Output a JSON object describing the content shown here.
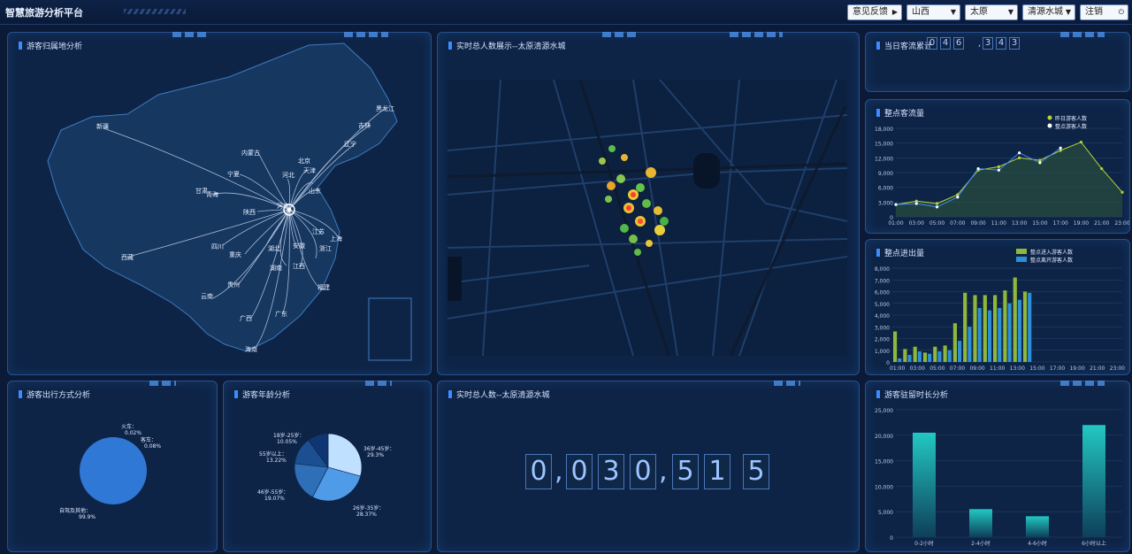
{
  "header": {
    "title": "智慧旅游分析平台",
    "feedback_label": "意见反馈",
    "selects": [
      {
        "value": "山西"
      },
      {
        "value": "太原"
      },
      {
        "value": "清源水城"
      }
    ],
    "logout_label": "注销"
  },
  "panels": {
    "origin": {
      "title": "游客归属地分析",
      "labels": [
        "黑龙江",
        "吉林",
        "辽宁",
        "新疆",
        "内蒙古",
        "宁夏",
        "甘肃",
        "青海",
        "北京",
        "天津",
        "河北",
        "山东",
        "陕西",
        "河南",
        "西藏",
        "四川",
        "重庆",
        "湖北",
        "安徽",
        "江苏",
        "上海",
        "浙江",
        "江西",
        "湖南",
        "贵州",
        "云南",
        "福建",
        "广西",
        "广东",
        "海南"
      ]
    },
    "realtime_map": {
      "title": "实时总人数展示--太原清源水城"
    },
    "daily": {
      "title": "当日客流累计",
      "digits": [
        "0",
        "4",
        "6",
        "3",
        "4",
        "3"
      ]
    },
    "hourly": {
      "title": "整点客流量"
    },
    "inout": {
      "title": "整点进出量"
    },
    "travel": {
      "title": "游客出行方式分析"
    },
    "age": {
      "title": "游客年龄分析"
    },
    "counter": {
      "title": "实时总人数--太原清源水城",
      "digits": [
        "0",
        "0",
        "3",
        "0",
        "5",
        "1",
        "5"
      ]
    },
    "stay": {
      "title": "游客驻留时长分析"
    }
  },
  "chart_data": [
    {
      "type": "line",
      "title": "整点客流量",
      "x": [
        "01:00",
        "03:00",
        "05:00",
        "07:00",
        "09:00",
        "11:00",
        "13:00",
        "15:00",
        "17:00",
        "19:00",
        "21:00",
        "23:00"
      ],
      "ylim": [
        0,
        18000
      ],
      "yticks": [
        0,
        3000,
        6000,
        9000,
        12000,
        15000,
        18000
      ],
      "series": [
        {
          "name": "昨日游客人数",
          "color": "#b9d336",
          "values": [
            2500,
            3200,
            2700,
            4500,
            9500,
            10200,
            12000,
            11500,
            13500,
            15200,
            9800,
            5000
          ]
        },
        {
          "name": "整点游客人数",
          "color": "#ffffff",
          "values": [
            2500,
            2700,
            2000,
            4000,
            9800,
            9500,
            13000,
            11000,
            14000
          ]
        }
      ]
    },
    {
      "type": "bar",
      "title": "整点进出量",
      "categories": [
        "01:00",
        "02:00",
        "03:00",
        "04:00",
        "05:00",
        "06:00",
        "07:00",
        "08:00",
        "09:00",
        "10:00",
        "11:00",
        "12:00",
        "13:00",
        "14:00",
        "15:00",
        "16:00",
        "17:00",
        "18:00",
        "19:00",
        "20:00",
        "21:00",
        "22:00",
        "23:00"
      ],
      "ylim": [
        0,
        8000
      ],
      "yticks": [
        0,
        1000,
        2000,
        3000,
        4000,
        5000,
        6000,
        7000,
        8000
      ],
      "series": [
        {
          "name": "整点进入游客人数",
          "color": "#8fb83a",
          "values": [
            2600,
            1100,
            1300,
            800,
            1300,
            1400,
            3300,
            5900,
            5700,
            5700,
            5700,
            6100,
            7200,
            6000,
            0,
            0,
            0,
            0,
            0,
            0,
            0,
            0,
            0
          ]
        },
        {
          "name": "整点离开游客人数",
          "color": "#2f8fd6",
          "values": [
            300,
            600,
            900,
            700,
            900,
            1000,
            1800,
            3000,
            4600,
            4400,
            4600,
            5000,
            5300,
            5900,
            0,
            0,
            0,
            0,
            0,
            0,
            0,
            0,
            0
          ]
        }
      ]
    },
    {
      "type": "pie",
      "title": "游客出行方式分析",
      "slices": [
        {
          "label": "火车：",
          "pct": "0.02%",
          "value": 0.02
        },
        {
          "label": "客车：",
          "pct": "0.08%",
          "value": 0.08
        },
        {
          "label": "自驾及其他：",
          "pct": "99.9%",
          "value": 99.9
        }
      ]
    },
    {
      "type": "pie",
      "title": "游客年龄分析",
      "slices": [
        {
          "label": "36岁-45岁：",
          "pct": "29.3%",
          "value": 29.3,
          "color": "#bfe0ff"
        },
        {
          "label": "26岁-35岁：",
          "pct": "28.37%",
          "value": 28.37,
          "color": "#4f9be8"
        },
        {
          "label": "46岁-55岁：",
          "pct": "19.07%",
          "value": 19.07,
          "color": "#2e6fb8"
        },
        {
          "label": "55岁以上：",
          "pct": "13.22%",
          "value": 13.22,
          "color": "#1c4f92"
        },
        {
          "label": "18岁-25岁：",
          "pct": "10.05%",
          "value": 10.05,
          "color": "#0f3672"
        }
      ]
    },
    {
      "type": "bar",
      "title": "游客驻留时长分析",
      "categories": [
        "0-2小时",
        "2-4小时",
        "4-6小时",
        "6小时以上"
      ],
      "values": [
        20500,
        5500,
        4100,
        22000
      ],
      "ylim": [
        0,
        25000
      ],
      "yticks": [
        0,
        5000,
        10000,
        15000,
        20000,
        25000
      ]
    }
  ]
}
